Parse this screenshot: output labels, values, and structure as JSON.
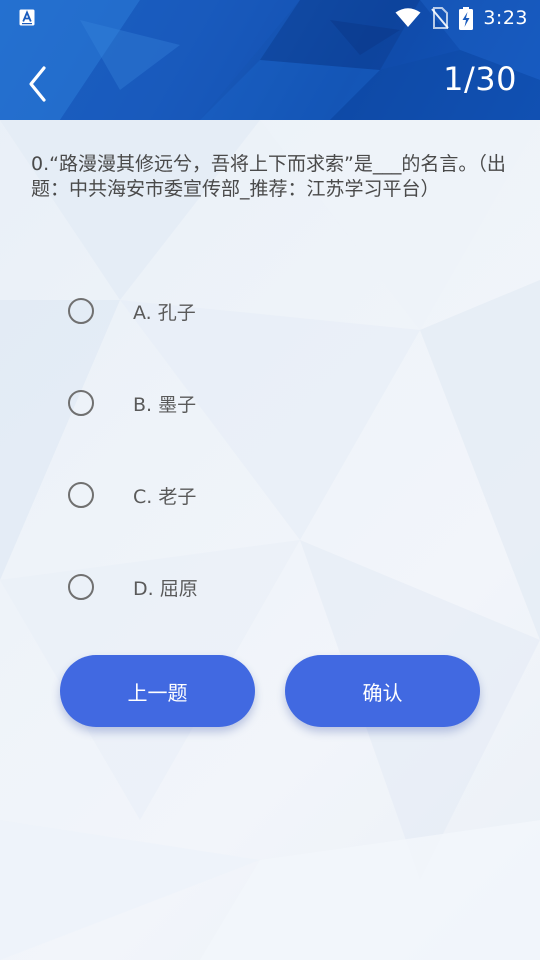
{
  "status_bar": {
    "time": "3:23"
  },
  "header": {
    "progress": "1/30",
    "back_icon": "chevron-left-icon"
  },
  "question": {
    "text": "0.“路漫漫其修远兮，吾将上下而求索”是___的名言。（出题：中共海安市委宣传部_推荐：江苏学习平台）"
  },
  "options": [
    {
      "label": "A. 孔子",
      "selected": false
    },
    {
      "label": "B. 墨子",
      "selected": false
    },
    {
      "label": "C. 老子",
      "selected": false
    },
    {
      "label": "D. 屈原",
      "selected": false
    }
  ],
  "buttons": {
    "prev_label": "上一题",
    "confirm_label": "确认"
  },
  "colors": {
    "header": "#1a5cbd",
    "accent_button": "#4169e1",
    "text": "#4a4a4a"
  }
}
